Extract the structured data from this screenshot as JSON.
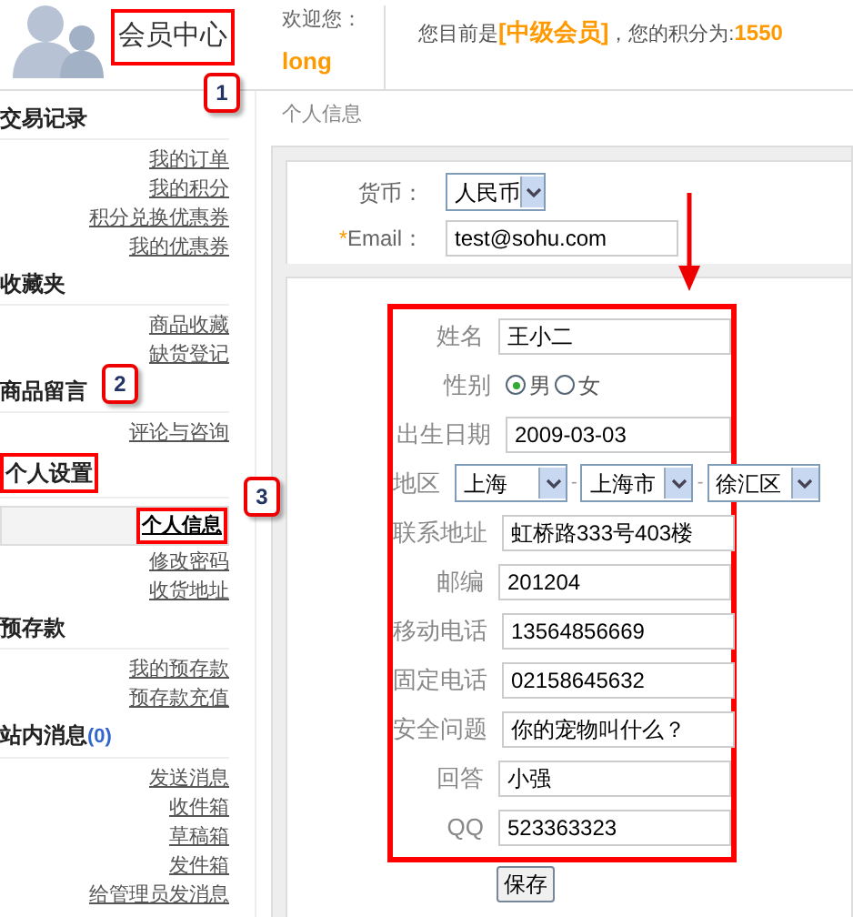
{
  "header": {
    "title": "会员中心",
    "highlighted": true,
    "welcome_label": "欢迎您：",
    "username": "long",
    "status_prefix": "您目前是",
    "member_level": "[中级会员]",
    "status_middle": "，您的积分为:",
    "points": "1550"
  },
  "sidebar": [
    {
      "title": "交易记录",
      "items": [
        {
          "label": "我的订单",
          "selected": false
        },
        {
          "label": "我的积分",
          "selected": false
        },
        {
          "label": "积分兑换优惠券",
          "selected": false
        },
        {
          "label": "我的优惠券",
          "selected": false
        }
      ]
    },
    {
      "title": "收藏夹",
      "items": [
        {
          "label": "商品收藏",
          "selected": false
        },
        {
          "label": "缺货登记",
          "selected": false
        }
      ]
    },
    {
      "title": "商品留言",
      "items": [
        {
          "label": "评论与咨询",
          "selected": false
        }
      ]
    },
    {
      "title": "个人设置",
      "highlighted": true,
      "items": [
        {
          "label": "个人信息",
          "selected": true,
          "highlighted": true
        },
        {
          "label": "修改密码",
          "selected": false
        },
        {
          "label": "收货地址",
          "selected": false
        }
      ]
    },
    {
      "title": "预存款",
      "items": [
        {
          "label": "我的预存款",
          "selected": false
        },
        {
          "label": "预存款充值",
          "selected": false
        }
      ]
    },
    {
      "title": "站内消息",
      "count": "(0)",
      "items": [
        {
          "label": "发送消息",
          "selected": false
        },
        {
          "label": "收件箱",
          "selected": false
        },
        {
          "label": "草稿箱",
          "selected": false
        },
        {
          "label": "发件箱",
          "selected": false
        },
        {
          "label": "给管理员发消息",
          "selected": false
        }
      ]
    }
  ],
  "breadcrumb": "个人信息",
  "account_fields": [
    {
      "kind": "select",
      "label": "货币：",
      "value": "人民币"
    },
    {
      "kind": "text",
      "label": "Email：",
      "required": true,
      "value": "test@sohu.com"
    }
  ],
  "profile_fields": [
    {
      "kind": "text",
      "label": "姓名",
      "value": "王小二"
    },
    {
      "kind": "radio",
      "label": "性别",
      "options": [
        {
          "label": "男",
          "selected": true
        },
        {
          "label": "女",
          "selected": false
        }
      ]
    },
    {
      "kind": "date",
      "label": "出生日期",
      "value": "2009-03-03"
    },
    {
      "kind": "region",
      "label": "地区",
      "values": [
        "上海",
        "上海市",
        "徐汇区"
      ],
      "separators": [
        "-",
        "-"
      ]
    },
    {
      "kind": "text",
      "label": "联系地址",
      "value": "虹桥路333号403楼"
    },
    {
      "kind": "text",
      "label": "邮编",
      "value": "201204"
    },
    {
      "kind": "text",
      "label": "移动电话",
      "value": "13564856669"
    },
    {
      "kind": "text",
      "label": "固定电话",
      "value": "02158645632"
    },
    {
      "kind": "text",
      "label": "安全问题",
      "value": "你的宠物叫什么？"
    },
    {
      "kind": "text",
      "label": "回答",
      "value": "小强"
    },
    {
      "kind": "text",
      "label": "QQ",
      "value": "523363323"
    }
  ],
  "save_button": "保存",
  "required_mark": "*",
  "callouts": [
    "1",
    "2",
    "3"
  ]
}
